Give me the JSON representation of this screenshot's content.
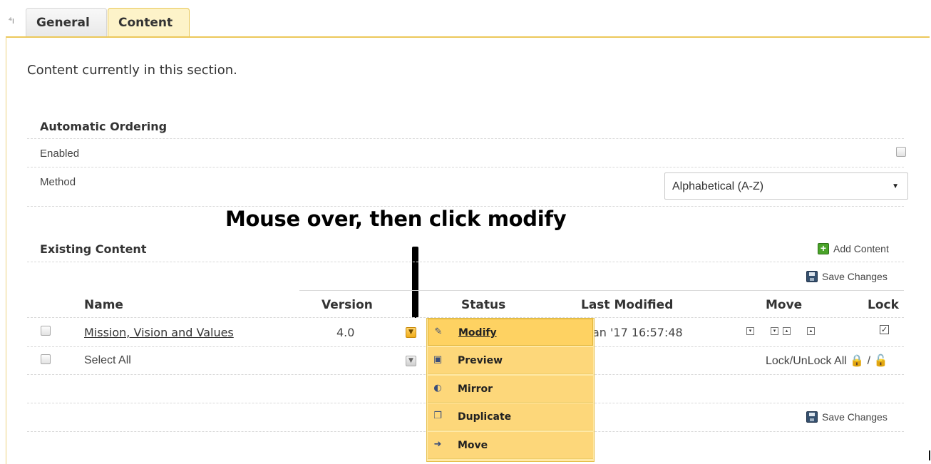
{
  "tabs": {
    "mini_icon": "⁴ı",
    "general": "General",
    "content": "Content"
  },
  "intro": "Content currently in this section.",
  "automatic_ordering": {
    "heading": "Automatic Ordering",
    "enabled_label": "Enabled",
    "method_label": "Method",
    "method_value": "Alphabetical (A-Z)",
    "caret": "▼"
  },
  "annotation": "Mouse over, then click modify",
  "existing_content": {
    "heading": "Existing Content",
    "add_content": "Add Content",
    "add_icon": "+",
    "save_changes": "Save Changes"
  },
  "table": {
    "columns": {
      "name": "Name",
      "version": "Version",
      "status": "Status",
      "last_modified": "Last Modified",
      "move": "Move",
      "lock": "Lock"
    },
    "rows": [
      {
        "name": "Mission, Vision and Values",
        "version": "4.0",
        "last_modified": "an '17 16:57:48"
      }
    ],
    "select_all": "Select All",
    "lock_all": "Lock/UnLock All",
    "lock_sep": "/",
    "lock_closed": "🔒",
    "lock_open": "🔓",
    "lock_check": "✓"
  },
  "move_glyphs": [
    "▾",
    "▾",
    "▴",
    "▴"
  ],
  "context_menu": {
    "items": [
      {
        "label": "Modify",
        "icon": "✎"
      },
      {
        "label": "Preview",
        "icon": "▣"
      },
      {
        "label": "Mirror",
        "icon": "◐"
      },
      {
        "label": "Duplicate",
        "icon": "❐"
      },
      {
        "label": "Move",
        "icon": "➜"
      }
    ]
  },
  "colors": {
    "accent": "#ecc85a",
    "menu_bg": "#fdd77a",
    "tab_active": "#fdf3c9"
  }
}
